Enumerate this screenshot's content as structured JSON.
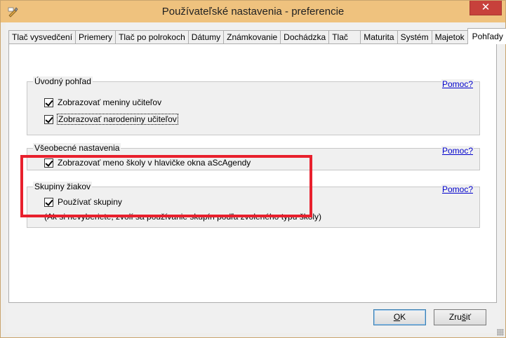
{
  "window": {
    "title": "Používateľské nastavenia - preferencie",
    "close_label": "✕"
  },
  "tabs": [
    {
      "label": "Tlač vysvedčení"
    },
    {
      "label": "Priemery"
    },
    {
      "label": "Tlač po polrokoch"
    },
    {
      "label": "Dátumy"
    },
    {
      "label": "Známkovanie"
    },
    {
      "label": "Dochádzka"
    },
    {
      "label": "Tlač"
    },
    {
      "label": "Maturita"
    },
    {
      "label": "Systém"
    },
    {
      "label": "Majetok"
    },
    {
      "label": "Pohľady",
      "active": true
    }
  ],
  "groups": {
    "uvodny": {
      "title": "Úvodný pohľad",
      "help": "Pomoc?",
      "items": [
        {
          "label": "Zobrazovať meniny učiteľov",
          "checked": true
        },
        {
          "label": "Zobrazovať narodeniny učiteľov",
          "checked": true
        }
      ]
    },
    "vseobecne": {
      "title": "Všeobecné nastavenia",
      "help": "Pomoc?",
      "items": [
        {
          "label": "Zobrazovať meno školy v hlavičke okna aScAgendy",
          "checked": true
        }
      ]
    },
    "skupiny": {
      "title": "Skupiny žiakov",
      "help": "Pomoc?",
      "items": [
        {
          "label": "Používať skupiny",
          "checked": true
        }
      ],
      "note": "(Ak si nevyberiete, zvolí sa používanie skupín podľa zvoleného typu školy)"
    }
  },
  "buttons": {
    "ok_prefix": "",
    "ok_mnemonic": "O",
    "ok_rest": "K",
    "cancel_prefix": "Zru",
    "cancel_mnemonic": "š",
    "cancel_rest": "iť"
  },
  "colors": {
    "titlebar": "#efc27e",
    "close": "#c7413b",
    "highlight": "#e8202d",
    "link": "#0000cc"
  }
}
